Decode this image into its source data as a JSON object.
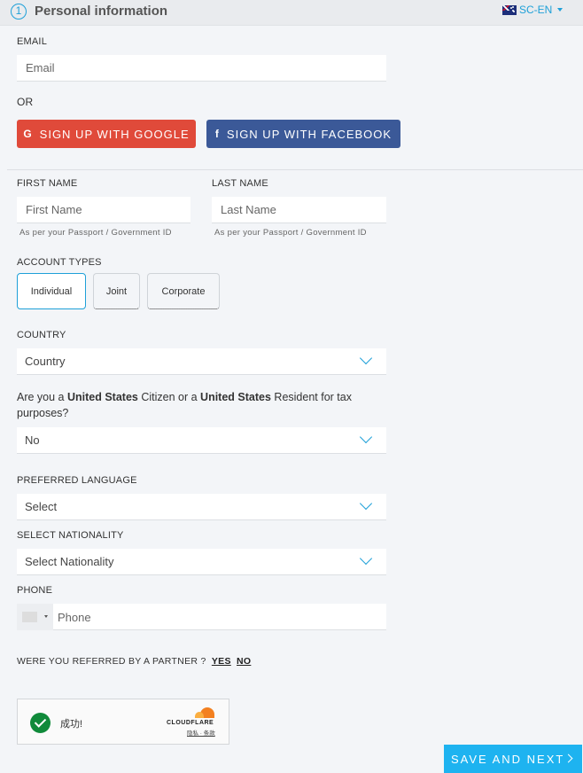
{
  "header": {
    "step_number": "1",
    "title": "Personal information",
    "language": "SC-EN",
    "flag_icon": "australia-flag-icon"
  },
  "email": {
    "label": "EMAIL",
    "placeholder": "Email"
  },
  "or_text": "OR",
  "social": {
    "google_icon": "G",
    "google_label": "SIGN UP WITH GOOGLE",
    "facebook_icon": "f",
    "facebook_label": "SIGN UP WITH FACEBOOK",
    "google_color": "#e04a3a",
    "facebook_color": "#3b5998"
  },
  "first_name": {
    "label": "FIRST NAME",
    "placeholder": "First Name",
    "hint": "As per your Passport / Government ID"
  },
  "last_name": {
    "label": "LAST NAME",
    "placeholder": "Last Name",
    "hint": "As per your Passport / Government ID"
  },
  "account_types": {
    "label": "ACCOUNT TYPES",
    "options": [
      "Individual",
      "Joint",
      "Corporate"
    ],
    "selected": "Individual"
  },
  "country": {
    "label": "COUNTRY",
    "value": "Country"
  },
  "us_question": {
    "part1": "Are you a ",
    "bold1": "United States",
    "part2": " Citizen or a ",
    "bold2": "United States",
    "part3": " Resident for tax purposes?",
    "value": "No"
  },
  "preferred_language": {
    "label": "PREFERRED LANGUAGE",
    "value": "Select"
  },
  "nationality": {
    "label": "SELECT NATIONALITY",
    "value": "Select Nationality"
  },
  "phone": {
    "label": "PHONE",
    "placeholder": "Phone"
  },
  "referral": {
    "question": "WERE YOU REFERRED BY A PARTNER ?",
    "yes": "YES",
    "no": "NO"
  },
  "captcha": {
    "status": "成功!",
    "brand": "CLOUDFLARE",
    "links": "隐私 · 条款"
  },
  "save_button": {
    "label": "SAVE AND NEXT",
    "color": "#1eb3f0"
  },
  "accent_color": "#1ea0d8"
}
